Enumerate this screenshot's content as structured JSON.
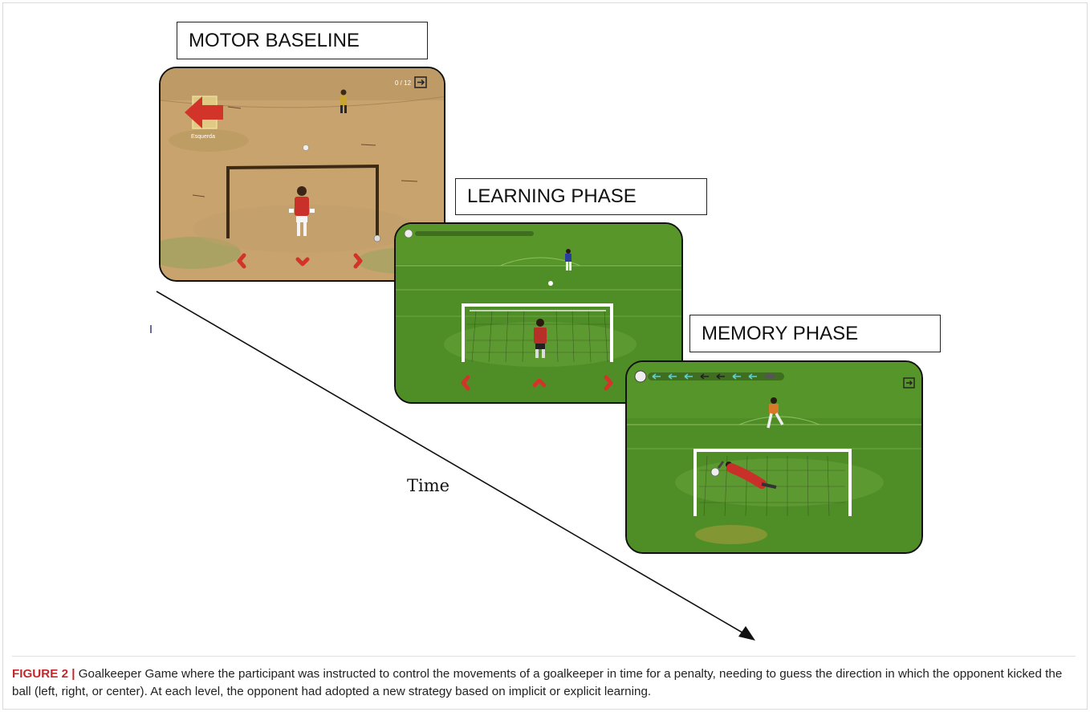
{
  "phases": {
    "motor": {
      "label": "MOTOR BASELINE",
      "counter": "0 / 12",
      "arrow_label": "Esquerda"
    },
    "learning": {
      "label": "LEARNING PHASE"
    },
    "memory": {
      "label": "MEMORY PHASE"
    }
  },
  "time_label": "Time",
  "caption": {
    "figure": "FIGURE 2 |",
    "text": " Goalkeeper Game where the participant was instructed to control the movements of a goalkeeper in time for a penalty, needing to guess the direction in which the opponent kicked the ball (left, right, or center). At each level, the opponent had adopted a new strategy based on implicit or explicit learning."
  },
  "colors": {
    "sand": "#c9a36e",
    "grass": "#4f8e26",
    "red_arrow": "#d2342a",
    "cyan_arrow": "#5fd0d0",
    "caption_red": "#c0282d"
  }
}
